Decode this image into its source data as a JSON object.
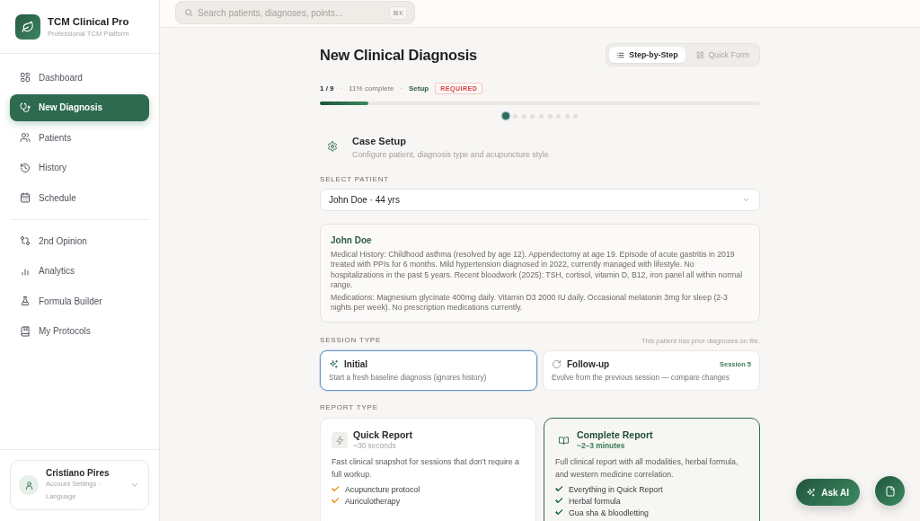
{
  "sidebar": {
    "brand": {
      "title": "TCM Clinical Pro",
      "subtitle": "Professional TCM Platform"
    },
    "nav_primary": [
      {
        "label": "Dashboard",
        "selected": false
      },
      {
        "label": "New Diagnosis",
        "selected": true
      },
      {
        "label": "Patients",
        "selected": false
      },
      {
        "label": "History",
        "selected": false
      },
      {
        "label": "Schedule",
        "selected": false
      }
    ],
    "nav_secondary": [
      {
        "label": "2nd Opinion",
        "selected": false
      },
      {
        "label": "Analytics",
        "selected": false
      },
      {
        "label": "Formula Builder",
        "selected": false
      },
      {
        "label": "My Protocols",
        "selected": false
      }
    ],
    "account": {
      "name": "Cristiano Pires",
      "links": "Account Settings · Language"
    }
  },
  "header": {
    "search": {
      "placeholder": "Search patients, diagnoses, points...",
      "shortcut": "⌘K"
    }
  },
  "page": {
    "title": "New Clinical Diagnosis",
    "modes": [
      {
        "label": "Step-by-Step",
        "selected": true
      },
      {
        "label": "Quick Form",
        "selected": false
      }
    ]
  },
  "progress": {
    "meta": [
      {
        "kind": "count",
        "text": "1 / 9"
      },
      {
        "kind": "sep",
        "text": "·"
      },
      {
        "kind": "text",
        "text": "11% complete"
      },
      {
        "kind": "sep",
        "text": "·"
      },
      {
        "kind": "step",
        "text": "Setup"
      },
      {
        "kind": "badge",
        "text": "REQUIRED"
      }
    ],
    "level": 0.11
  },
  "step_dots": [
    {
      "selected": true
    },
    {
      "selected": false
    },
    {
      "selected": false
    },
    {
      "selected": false
    },
    {
      "selected": false
    },
    {
      "selected": false
    },
    {
      "selected": false
    },
    {
      "selected": false
    },
    {
      "selected": false
    }
  ],
  "section": {
    "title": "Case Setup",
    "subtitle": "Configure patient, diagnosis type and acupuncture style"
  },
  "patient_select": {
    "label": "SELECT PATIENT",
    "value": "John Doe · 44 yrs"
  },
  "patient_card": {
    "name": "John Doe",
    "history": "Medical History: Childhood asthma (resolved by age 12). Appendectomy at age 19. Episode of acute gastritis in 2019 treated with PPIs for 6 months. Mild hypertension diagnosed in 2022, currently managed with lifestyle. No hospitalizations in the past 5 years. Recent bloodwork (2025): TSH, cortisol, vitamin D, B12, iron panel all within normal range.",
    "medications": "Medications: Magnesium glycinate 400mg daily. Vitamin D3 2000 IU daily. Occasional melatonin 3mg for sleep (2-3 nights per week). No prescription medications currently."
  },
  "session_type": {
    "label": "SESSION TYPE",
    "note": "This patient has prior diagnoses on file.",
    "options": [
      {
        "title": "Initial",
        "description": "Start a fresh baseline diagnosis (ignores history)",
        "selected": true
      },
      {
        "title": "Follow-up",
        "description": "Evolve from the previous session — compare changes",
        "badge": "Session 5",
        "selected": false
      }
    ]
  },
  "report_type": {
    "label": "REPORT TYPE",
    "options": [
      {
        "title": "Quick Report",
        "duration": "~30 seconds",
        "description": "Fast clinical snapshot for sessions that don't require a full workup.",
        "features": [
          "Acupuncture protocol",
          "Auriculotherapy"
        ],
        "color": "#e9a43c",
        "selected": false
      },
      {
        "title": "Complete Report",
        "duration": "~2–3 minutes",
        "description": "Full clinical report with all modalities, herbal formula, and western medicine correlation.",
        "features": [
          "Everything in Quick Report",
          "Herbal formula",
          "Gua sha & bloodletting"
        ],
        "color": "#3a7a57",
        "selected": true
      }
    ]
  },
  "actions": {
    "ask_ai": "Ask AI"
  }
}
